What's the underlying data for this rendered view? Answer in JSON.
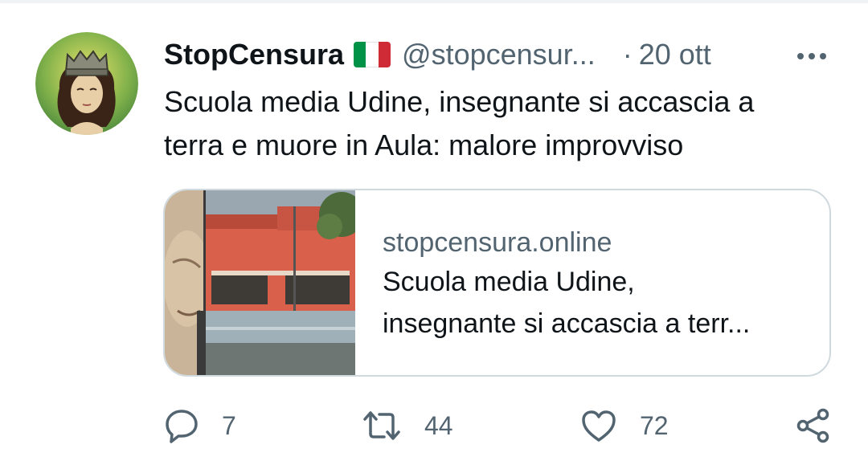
{
  "tweet": {
    "display_name": "StopCensura",
    "handle": "@stopcensur...",
    "separator": "·",
    "timestamp": "20 ott",
    "text_line1": "Scuola media Udine, insegnante si accascia a",
    "text_line2": "terra e muore in Aula: malore improvviso",
    "flag_colors": [
      "#009246",
      "#ffffff",
      "#ce2b37"
    ]
  },
  "card": {
    "domain": "stopcensura.online",
    "title_line1": "Scuola media Udine,",
    "title_line2": "insegnante si accascia a terr..."
  },
  "actions": {
    "reply_count": "7",
    "retweet_count": "44",
    "like_count": "72"
  },
  "icons": [
    "more-icon",
    "reply-icon",
    "retweet-icon",
    "like-icon",
    "share-icon"
  ],
  "colors": {
    "text": "#0f1419",
    "secondary": "#536471",
    "border": "#cfd9de"
  }
}
